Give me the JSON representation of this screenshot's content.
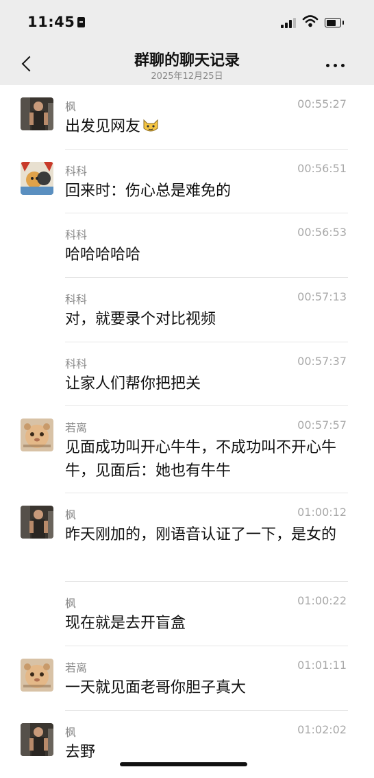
{
  "status_bar": {
    "time": "11:45"
  },
  "nav": {
    "title": "群聊的聊天记录",
    "subtitle": "2025年12月25日"
  },
  "messages": [
    {
      "sender": "枫",
      "time": "00:55:27",
      "text": "出发见网友",
      "has_cat_emoji": true,
      "avatar": "feng"
    },
    {
      "sender": "科科",
      "time": "00:56:51",
      "text": "回来时：伤心总是难免的",
      "avatar": "keke"
    },
    {
      "sender": "科科",
      "time": "00:56:53",
      "text": "哈哈哈哈哈"
    },
    {
      "sender": "科科",
      "time": "00:57:13",
      "text": "对，就要录个对比视频"
    },
    {
      "sender": "科科",
      "time": "00:57:37",
      "text": "让家人们帮你把把关"
    },
    {
      "sender": "若离",
      "time": "00:57:57",
      "text": "见面成功叫开心牛牛，不成功叫不开心牛牛，见面后：她也有牛牛",
      "avatar": "ruoli"
    },
    {
      "sender": "枫",
      "time": "01:00:12",
      "text": "昨天刚加的，刚语音认证了一下，是女的",
      "avatar": "feng"
    },
    {
      "sender": "枫",
      "time": "01:00:22",
      "text": "现在就是去开盲盒"
    },
    {
      "sender": "若离",
      "time": "01:01:11",
      "text": "一天就见面老哥你胆子真大",
      "avatar": "ruoli"
    },
    {
      "sender": "枫",
      "time": "01:02:02",
      "text": "去野",
      "avatar": "feng"
    }
  ]
}
